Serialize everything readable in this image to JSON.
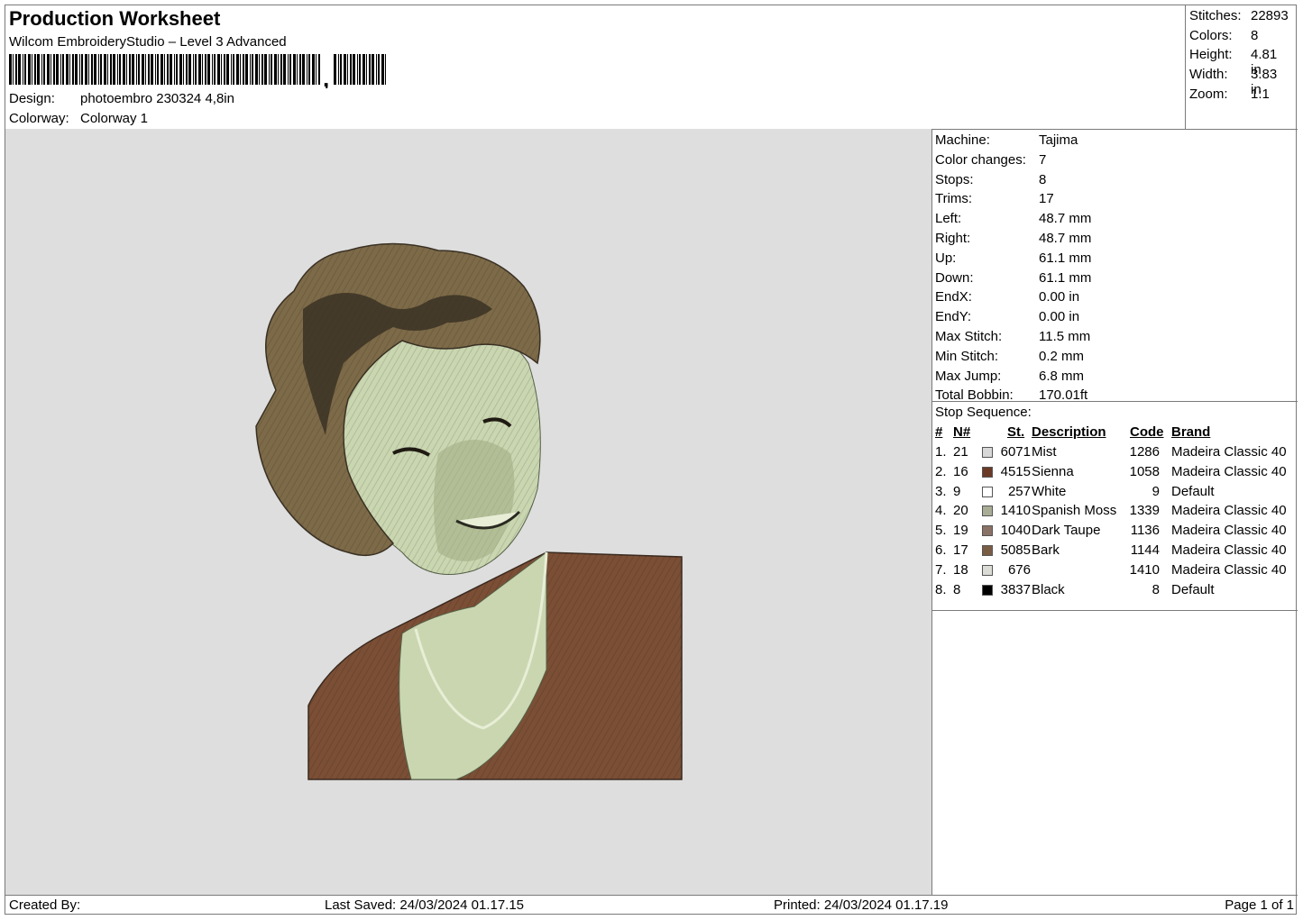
{
  "header": {
    "title": "Production Worksheet",
    "subtitle": "Wilcom EmbroideryStudio – Level 3 Advanced",
    "design_label": "Design:",
    "design_value": "photoembro 230324 4,8in",
    "colorway_label": "Colorway:",
    "colorway_value": "Colorway 1"
  },
  "stats": [
    {
      "label": "Stitches:",
      "value": "22893"
    },
    {
      "label": "Colors:",
      "value": "8"
    },
    {
      "label": "Height:",
      "value": "4.81 in"
    },
    {
      "label": "Width:",
      "value": "3.83 in"
    },
    {
      "label": "Zoom:",
      "value": "1:1"
    }
  ],
  "machine": [
    {
      "label": "Machine:",
      "value": "Tajima"
    },
    {
      "label": "Color changes:",
      "value": "7"
    },
    {
      "label": "Stops:",
      "value": "8"
    },
    {
      "label": "Trims:",
      "value": "17"
    },
    {
      "label": "Left:",
      "value": "48.7 mm"
    },
    {
      "label": "Right:",
      "value": "48.7 mm"
    },
    {
      "label": "Up:",
      "value": "61.1 mm"
    },
    {
      "label": "Down:",
      "value": "61.1 mm"
    },
    {
      "label": "EndX:",
      "value": "0.00 in"
    },
    {
      "label": "EndY:",
      "value": "0.00 in"
    },
    {
      "label": "Max Stitch:",
      "value": "11.5 mm"
    },
    {
      "label": "Min Stitch:",
      "value": "0.2 mm"
    },
    {
      "label": "Max Jump:",
      "value": "6.8 mm"
    },
    {
      "label": "Total Bobbin:",
      "value": "170.01ft"
    }
  ],
  "stop_sequence": {
    "title": "Stop Sequence:",
    "columns": [
      "#",
      "N#",
      "St.",
      "Description",
      "Code",
      "Brand"
    ],
    "rows": [
      {
        "idx": "1.",
        "n": "21",
        "color": "#d8d8d8",
        "st": "6071",
        "desc": "Mist",
        "code": "1286",
        "brand": "Madeira Classic 40"
      },
      {
        "idx": "2.",
        "n": "16",
        "color": "#6b3a26",
        "st": "4515",
        "desc": "Sienna",
        "code": "1058",
        "brand": "Madeira Classic 40"
      },
      {
        "idx": "3.",
        "n": "9",
        "color": "#ffffff",
        "st": "257",
        "desc": "White",
        "code": "9",
        "brand": "Default"
      },
      {
        "idx": "4.",
        "n": "20",
        "color": "#a9ad96",
        "st": "1410",
        "desc": "Spanish Moss",
        "code": "1339",
        "brand": "Madeira Classic 40"
      },
      {
        "idx": "5.",
        "n": "19",
        "color": "#8a7266",
        "st": "1040",
        "desc": "Dark Taupe",
        "code": "1136",
        "brand": "Madeira Classic 40"
      },
      {
        "idx": "6.",
        "n": "17",
        "color": "#7a5d45",
        "st": "5085",
        "desc": "Bark",
        "code": "1144",
        "brand": "Madeira Classic 40"
      },
      {
        "idx": "7.",
        "n": "18",
        "color": "#dcdcd6",
        "st": "676",
        "desc": "",
        "code": "1410",
        "brand": "Madeira Classic 40"
      },
      {
        "idx": "8.",
        "n": "8",
        "color": "#000000",
        "st": "3837",
        "desc": "Black",
        "code": "8",
        "brand": "Default"
      }
    ]
  },
  "footer": {
    "created_by": "Created By:",
    "last_saved": "Last Saved: 24/03/2024 01.17.15",
    "printed": "Printed: 24/03/2024 01.17.19",
    "page": "Page 1 of 1"
  },
  "colors": {
    "canvas_bg": "#dedede",
    "hair": "#7d6a48",
    "hair_dark": "#3a3124",
    "skin": "#c9d6b0",
    "skin_shadow": "#a4ae86",
    "jacket": "#7b4f35"
  }
}
